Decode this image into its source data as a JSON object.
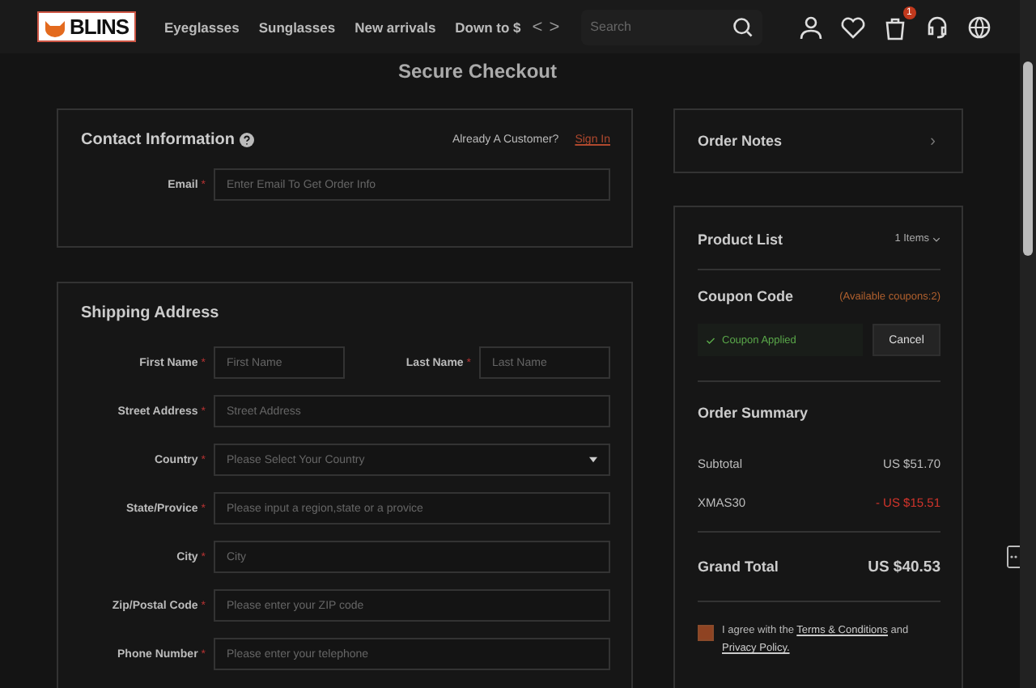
{
  "header": {
    "logo": "BLINS",
    "nav": [
      "Eyeglasses",
      "Sunglasses",
      "New arrivals",
      "Down to $"
    ],
    "prev": "<",
    "next": ">",
    "search": {
      "placeholder": "Search"
    },
    "cart_count": "1"
  },
  "page_title": "Secure Checkout",
  "contact": {
    "title": "Contact Information",
    "prompt": "Already A Customer?",
    "sign_in": "Sign In",
    "fields": [
      {
        "label": "Email",
        "required_mark": "*",
        "placeholder": "Enter Email To Get Order Info"
      }
    ]
  },
  "shipping": {
    "title": "Shipping Address",
    "name_fields": [
      {
        "label": "First Name",
        "required_mark": "*",
        "placeholder": "First Name"
      },
      {
        "label": "Last Name",
        "required_mark": "*",
        "placeholder": "Last Name"
      }
    ],
    "fields": [
      {
        "label": "Street Address",
        "required_mark": "*",
        "placeholder": "Street Address",
        "kind": "text"
      },
      {
        "label": "Country",
        "required_mark": "*",
        "placeholder": "Please Select Your Country",
        "kind": "select"
      },
      {
        "label": "State/Provice",
        "required_mark": "*",
        "placeholder": "Please input a region,state or a provice",
        "kind": "text"
      },
      {
        "label": "City",
        "required_mark": "*",
        "placeholder": "City",
        "kind": "text"
      },
      {
        "label": "Zip/Postal Code",
        "required_mark": "*",
        "placeholder": "Please enter your ZIP code",
        "kind": "text"
      },
      {
        "label": "Phone Number",
        "required_mark": "*",
        "placeholder": "Please enter your telephone",
        "kind": "text"
      }
    ]
  },
  "order_notes": {
    "title": "Order Notes",
    "arrow": "›"
  },
  "product_list": {
    "title": "Product List",
    "count": "1 Items"
  },
  "coupon": {
    "title": "Coupon Code",
    "available": "(Available coupons:2)",
    "status": "Coupon Applied",
    "button": "Cancel"
  },
  "summary": {
    "title": "Order Summary",
    "lines": [
      {
        "label": "Subtotal",
        "value": "US $51.70",
        "kind": "normal"
      },
      {
        "label": "XMAS30",
        "value": "- US $15.51",
        "kind": "discount"
      }
    ],
    "total_label": "Grand Total",
    "total": "US $40.53"
  },
  "agreement": {
    "checked": true,
    "prefix": "I agree with the",
    "terms": "Terms & Conditions",
    "middle": "and",
    "privacy": "Privacy Policy."
  }
}
